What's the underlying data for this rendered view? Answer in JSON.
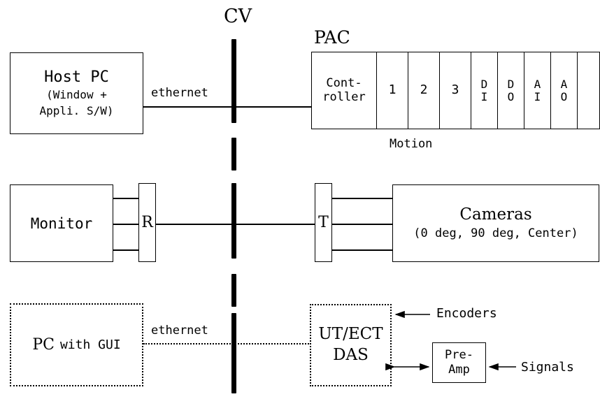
{
  "diagram": {
    "bus": {
      "label": "CV"
    },
    "row1": {
      "host_pc": {
        "title": "Host PC",
        "line2": "(Window +",
        "line3": "Appli. S/W)"
      },
      "ethernet_label": "ethernet",
      "pac": {
        "title": "PAC",
        "controller_line1": "Cont-",
        "controller_line2": "roller",
        "slots": [
          "1",
          "2",
          "3"
        ],
        "io": [
          {
            "line1": "D",
            "line2": "I"
          },
          {
            "line1": "D",
            "line2": "O"
          },
          {
            "line1": "A",
            "line2": "I"
          },
          {
            "line1": "A",
            "line2": "O"
          }
        ],
        "empty_slot": "",
        "motion_label": "Motion"
      }
    },
    "row2": {
      "monitor": {
        "title": "Monitor"
      },
      "repeater": {
        "label": "R"
      },
      "transmitter": {
        "label": "T"
      },
      "cameras": {
        "title": "Cameras",
        "subtitle": "(0 deg, 90 deg, Center)"
      }
    },
    "row3": {
      "pc_gui": {
        "prefix": "PC",
        "suffix": "with GUI"
      },
      "ethernet_label": "ethernet",
      "das": {
        "line1": "UT/ECT",
        "line2": "DAS"
      },
      "preamp": {
        "line1": "Pre-",
        "line2": "Amp"
      },
      "encoders_label": "Encoders",
      "signals_label": "Signals"
    }
  },
  "colors": {
    "stroke": "#000000",
    "background": "#ffffff"
  }
}
